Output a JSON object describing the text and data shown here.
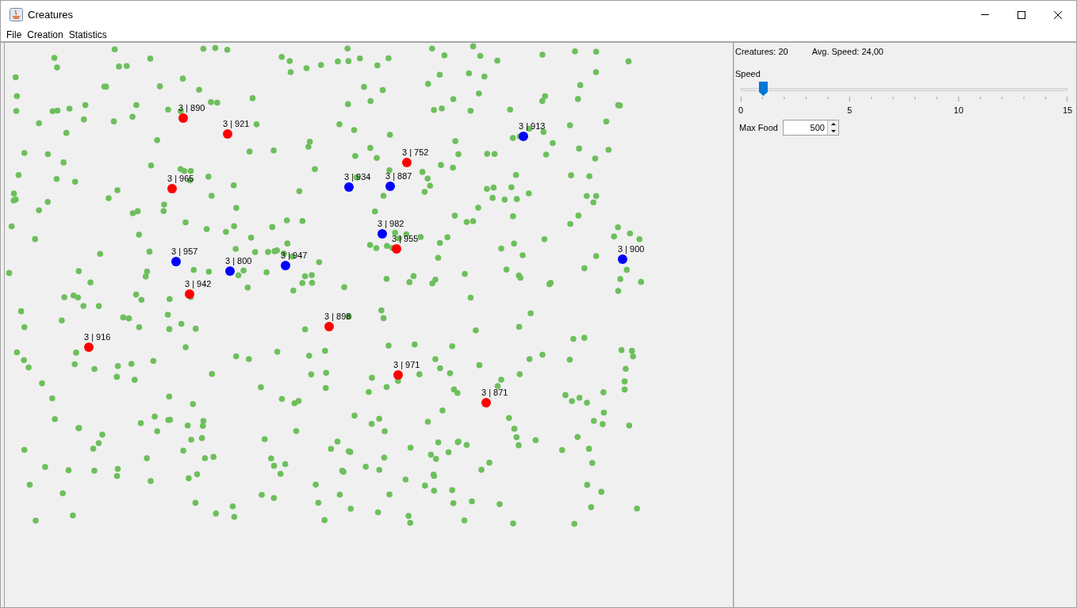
{
  "window": {
    "title": "Creatures"
  },
  "menu": [
    "File",
    "Creation",
    "Statistics"
  ],
  "creatures": [
    {
      "label": "3 | 890",
      "color": "#ff0000"
    },
    {
      "label": "3 | 921",
      "color": "#ff0000"
    },
    {
      "label": "3 | 913",
      "color": "#0000ff"
    },
    {
      "label": "3 | 752",
      "color": "#ff0000"
    },
    {
      "label": "3 | 965",
      "color": "#ff0000"
    },
    {
      "label": "3 | 934",
      "color": "#0000ff"
    },
    {
      "label": "3 | 887",
      "color": "#0000ff"
    },
    {
      "label": "3 | 982",
      "color": "#0000ff"
    },
    {
      "label": "3 | 955",
      "color": "#ff0000"
    },
    {
      "label": "3 | 957",
      "color": "#0000ff"
    },
    {
      "label": "3 | 800",
      "color": "#0000ff"
    },
    {
      "label": "3 | 947",
      "color": "#0000ff"
    },
    {
      "label": "3 | 900",
      "color": "#0000ff"
    },
    {
      "label": "3 | 942",
      "color": "#ff0000"
    },
    {
      "label": "3 | 898",
      "color": "#ff0000"
    },
    {
      "label": "3 | 916",
      "color": "#ff0000"
    },
    {
      "label": "3 | 971",
      "color": "#ff0000"
    },
    {
      "label": "3 | 871",
      "color": "#ff0000"
    }
  ],
  "stats": {
    "creatures": "Creatures: 20",
    "avg_speed": "Avg. Speed: 24,00"
  },
  "speed_slider": {
    "label": "Speed",
    "level": 0.068,
    "tick_labels": [
      "0",
      "5",
      "10",
      "15"
    ]
  },
  "max_food": {
    "label": "Max Food",
    "value": "500"
  }
}
